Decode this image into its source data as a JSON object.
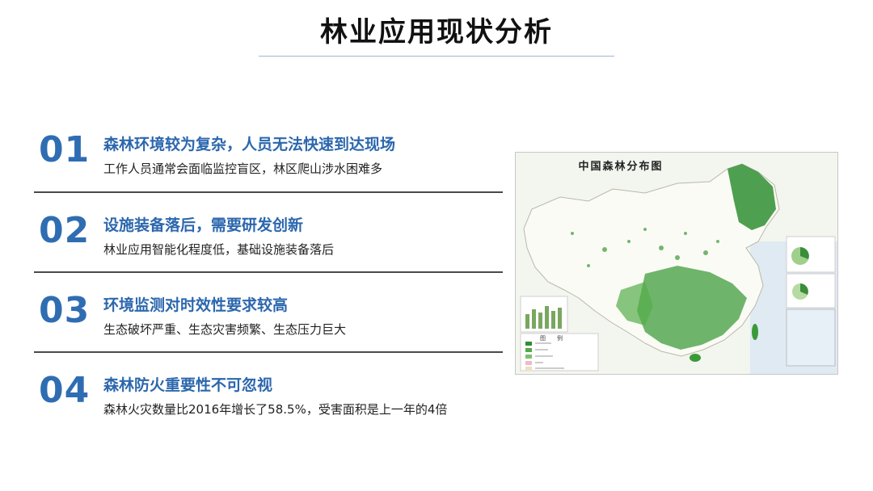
{
  "page": {
    "title": "林业应用现状分析"
  },
  "items": [
    {
      "number": "01",
      "heading": "森林环境较为复杂，人员无法快速到达现场",
      "description": "工作人员通常会面临监控盲区，林区爬山涉水困难多"
    },
    {
      "number": "02",
      "heading": "设施装备落后，需要研发创新",
      "description": "林业应用智能化程度低，基础设施装备落后"
    },
    {
      "number": "03",
      "heading": "环境监测对时效性要求较高",
      "description": "生态破坏严重、生态灾害频繁、生态压力巨大"
    },
    {
      "number": "04",
      "heading": "森林防火重要性不可忽视",
      "description": "森林火灾数量比2016年增长了58.5%，受害面积是上一年的4倍"
    }
  ],
  "map": {
    "title": "中国森林分布图",
    "legend_title": "图　　例"
  },
  "colors": {
    "accent": "#2f6db3",
    "heading": "#2c67ad",
    "forest": "#3c9a3a",
    "divider": "#4a4a4a"
  }
}
